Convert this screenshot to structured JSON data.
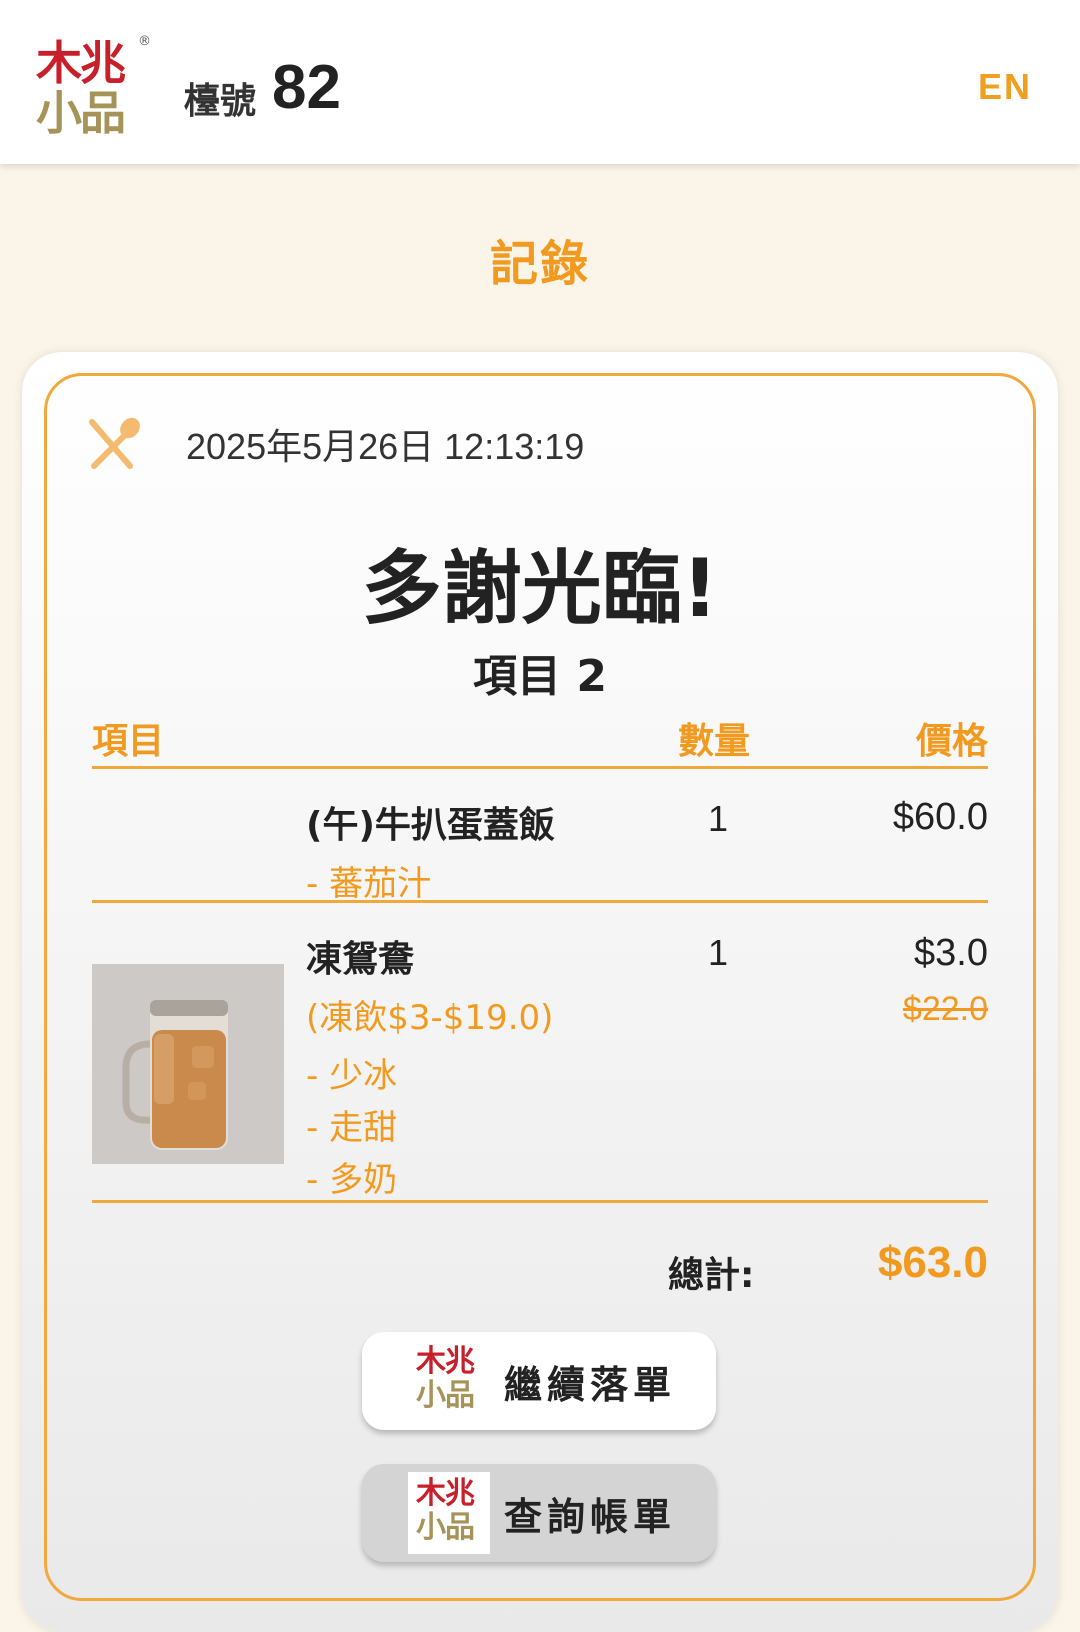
{
  "header": {
    "logo": {
      "line1": "木兆",
      "line2": "小品",
      "registered": "®"
    },
    "table_label": "檯號",
    "table_number": "82",
    "language_toggle": "EN"
  },
  "page_title": "記錄",
  "receipt": {
    "datetime": "2025年5月26日 12:13:19",
    "utensil_icon": "fork-spoon-icon",
    "thanks": "多謝光臨!",
    "items_count": "項目 2",
    "columns": {
      "item": "項目",
      "qty": "數量",
      "price": "價格"
    },
    "items": [
      {
        "name": "(午)牛扒蛋蓋飯",
        "qty": "1",
        "price": "$60.0",
        "options": [
          "- 蕃茄汁"
        ]
      },
      {
        "name": "凍鴛鴦",
        "qty": "1",
        "price": "$3.0",
        "original_price": "$22.0",
        "promo": "(凍飲$3-$19.0)",
        "options": [
          "- 少冰",
          "- 走甜",
          "- 多奶"
        ],
        "image": "iced-milk-tea-glass"
      }
    ],
    "total_label": "總計:",
    "total_value": "$63.0"
  },
  "buttons": {
    "continue_order": "繼續落單",
    "check_bill": "查詢帳單"
  },
  "colors": {
    "accent": "#f29a1f",
    "logo_red": "#c8202a",
    "logo_gold": "#a59358",
    "background": "#fbf5e9"
  }
}
